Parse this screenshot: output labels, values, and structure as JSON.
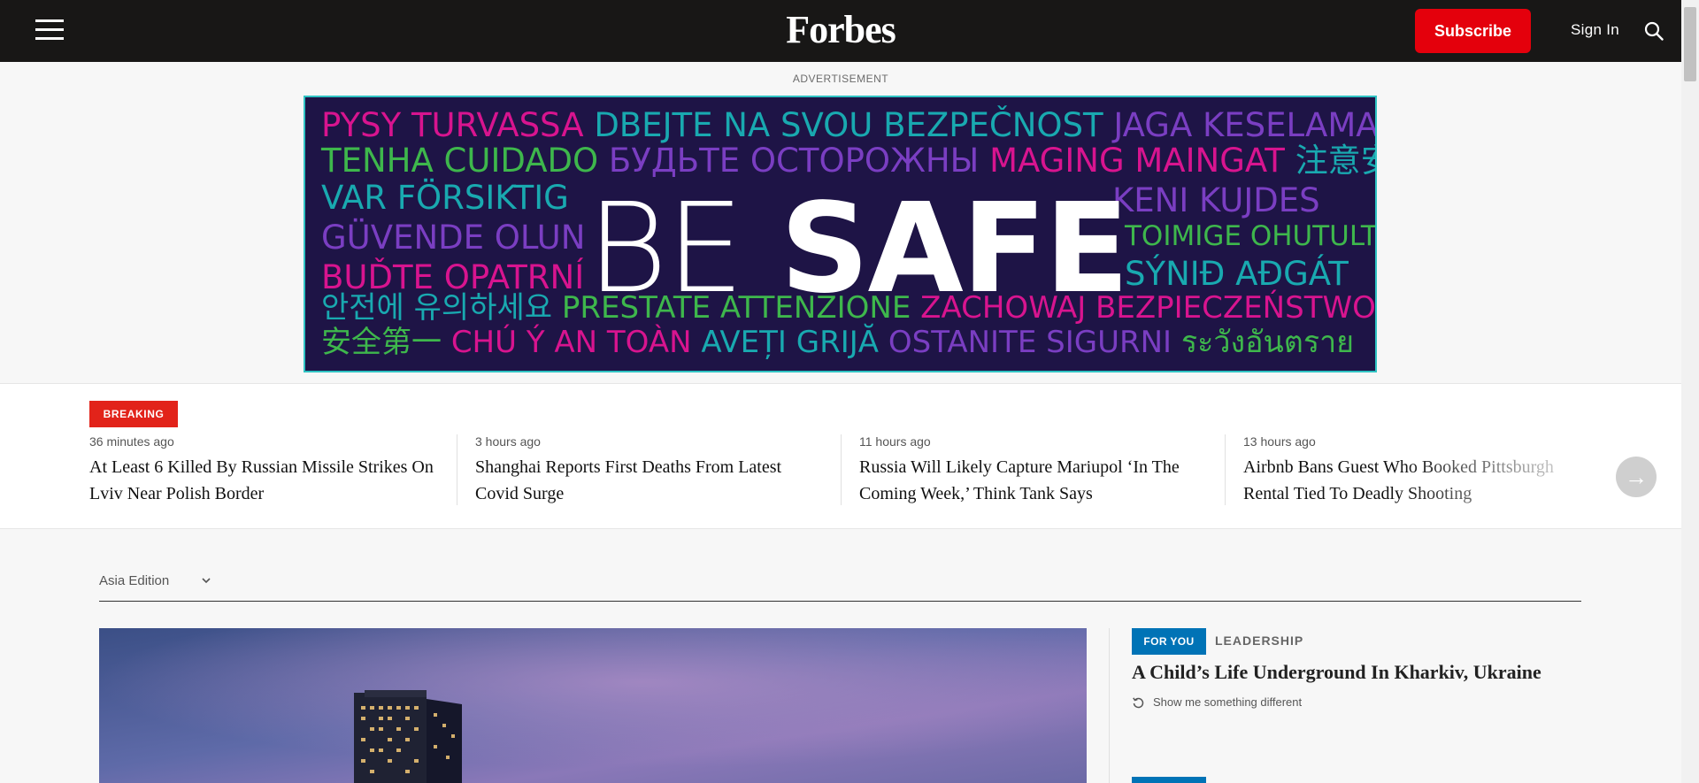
{
  "header": {
    "logo": "Forbes",
    "subscribe_label": "Subscribe",
    "signin_label": "Sign In"
  },
  "ad": {
    "label": "ADVERTISEMENT",
    "rows": [
      [
        "PYSY TURVASSA",
        "DBEJTE NA SVOU BEZPEČNOST",
        "JAGA KESELAMATAN"
      ],
      [
        "TENHA CUIDADO",
        "БУДЬТЕ ОСТОРОЖНЫ",
        "MAGING MAINGAT",
        "注意安全"
      ],
      [
        "VAR FÖRSIKTIG"
      ],
      [
        "GÜVENDE OLUN"
      ],
      [
        "BUĎTE OPATRNÍ"
      ],
      [
        "안전에 유의하세요",
        "PRESTATE ATTENZIONE",
        "ZACHOWAJ BEZPIECZEŃSTWO"
      ],
      [
        "安全第一",
        "CHÚ Ý AN TOÀN",
        "AVEȚI GRIJĂ",
        "OSTANITE SIGURNI",
        "ระวังอันตราย"
      ]
    ],
    "right_words": [
      "KENI KUJDES",
      "TOIMIGE OHUTULT",
      "SÝNIÐ AÐGÁT"
    ],
    "big_be": "BE",
    "big_safe": "SAFE"
  },
  "breaking": {
    "badge": "BREAKING",
    "stories": [
      {
        "time": "36 minutes ago",
        "headline": "At Least 6 Killed By Russian Missile Strikes On Lviv Near Polish Border"
      },
      {
        "time": "3 hours ago",
        "headline": "Shanghai Reports First Deaths From Latest Covid Surge"
      },
      {
        "time": "11 hours ago",
        "headline": "Russia Will Likely Capture Mariupol ‘In The Coming Week,’ Think Tank Says"
      },
      {
        "time": "13 hours ago",
        "headline": "Airbnb Bans Guest Who Booked Pittsburgh Rental Tied To Deadly Shooting"
      }
    ]
  },
  "edition": {
    "selected": "Asia Edition"
  },
  "right_column": {
    "tag": "FOR YOU",
    "category": "LEADERSHIP",
    "headline": "A Child’s Life Underground In Kharkiv, Ukraine",
    "show_different": "Show me something different"
  },
  "icons": [
    "hamburger-menu-icon",
    "search-icon",
    "chevron-down-icon",
    "arrow-right-icon",
    "refresh-icon"
  ],
  "colors": {
    "nav_bg": "#181716",
    "subscribe": "#e4000c",
    "breaking": "#e2231a",
    "for_you": "#0073b6",
    "ad_bg": "#1e1446"
  }
}
